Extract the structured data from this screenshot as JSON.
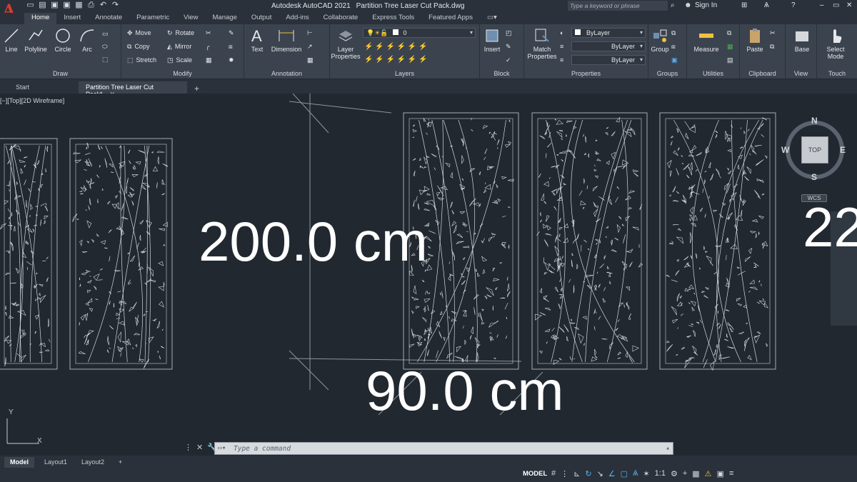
{
  "app": {
    "logo_letter": "A",
    "title": "Autodesk AutoCAD 2021",
    "filename": "Partition Tree Laser Cut Pack.dwg",
    "search_placeholder": "Type a keyword or phrase",
    "sign_in": "Sign In"
  },
  "ribbon_tabs": [
    "Home",
    "Insert",
    "Annotate",
    "Parametric",
    "View",
    "Manage",
    "Output",
    "Add-ins",
    "Collaborate",
    "Express Tools",
    "Featured Apps"
  ],
  "ribbon": {
    "draw": {
      "title": "Draw",
      "line": "Line",
      "polyline": "Polyline",
      "circle": "Circle",
      "arc": "Arc"
    },
    "modify": {
      "title": "Modify",
      "move": "Move",
      "rotate": "Rotate",
      "copy": "Copy",
      "mirror": "Mirror",
      "stretch": "Stretch",
      "scale": "Scale"
    },
    "annotation": {
      "title": "Annotation",
      "text": "Text",
      "dimension": "Dimension"
    },
    "layers": {
      "title": "Layers",
      "layer_properties_1": "Layer",
      "layer_properties_2": "Properties",
      "current_layer": "0"
    },
    "block": {
      "title": "Block",
      "insert": "Insert"
    },
    "properties": {
      "title": "Properties",
      "match_1": "Match",
      "match_2": "Properties",
      "color": "ByLayer",
      "linetype": "ByLayer",
      "lineweight": "ByLayer"
    },
    "groups": {
      "title": "Groups",
      "group": "Group"
    },
    "utilities": {
      "title": "Utilities",
      "measure": "Measure"
    },
    "clipboard": {
      "title": "Clipboard",
      "paste": "Paste"
    },
    "view": {
      "title": "View",
      "base": "Base"
    },
    "touch": {
      "title": "Touch",
      "select_1": "Select",
      "select_2": "Mode"
    }
  },
  "file_tabs": {
    "start": "Start",
    "active": "Partition Tree Laser Cut Pack*"
  },
  "viewport": {
    "label": "[−][Top][2D Wireframe]",
    "dim_height": "200.0 cm",
    "dim_width": "90.0 cm",
    "dim_partial": "22",
    "viewcube": {
      "face": "TOP",
      "n": "N",
      "s": "S",
      "e": "E",
      "w": "W"
    },
    "wcs": "WCS",
    "ucs_y": "Y",
    "ucs_x": "X"
  },
  "command": {
    "placeholder": "Type a command"
  },
  "layout_tabs": [
    "Model",
    "Layout1",
    "Layout2"
  ],
  "status": {
    "model": "MODEL",
    "scale": "1:1"
  }
}
